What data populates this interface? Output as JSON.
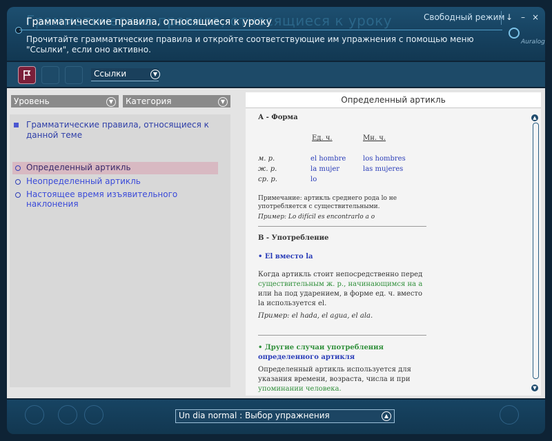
{
  "header": {
    "ghost_title": "Грамматические правила, относящиеся к уроку",
    "title": "Грамматические правила, относящиеся к уроку",
    "subtitle": "Прочитайте грамматические правила и откройте соответствующие им упражнения с помощью меню \"Ссылки\", если оно активно.",
    "mode_label": "Свободный режим",
    "brand": "Auralog",
    "help_icon": "↓",
    "minimize_icon": "–",
    "close_icon": "×"
  },
  "toolbar": {
    "links_label": "Ссылки"
  },
  "left": {
    "filter_level": "Уровень",
    "filter_category": "Категория",
    "group_title": "Грамматические правила, относящиеся к данной теме",
    "rules": [
      "Определенный артикль",
      "Неопределенный артикль",
      "Настоящее время изъявительного наклонения"
    ]
  },
  "right": {
    "header": "Определенный артикль",
    "sec_a": "А - Форма",
    "col_sing": "Ед. ч.",
    "col_plur": "Мн. ч.",
    "rows": [
      {
        "label": "м. р.",
        "sing": "el hombre",
        "plur": "los hombres"
      },
      {
        "label": "ж. р.",
        "sing": "la mujer",
        "plur": "las mujeres"
      },
      {
        "label": "ср. р.",
        "sing": "lo",
        "plur": ""
      }
    ],
    "note1": "Примечание: артикль среднего рода lo не",
    "note2": "употребляется с существительными.",
    "example1": "Пример: Lo difícil es encontrarlo a o",
    "sec_b": "В - Употребление",
    "sub1": "• El вместо la",
    "p1_1": "Когда артикль стоит непосредственно перед",
    "p1_2": "существительным ж. р., начинающимся на а",
    "p1_3": "или ha под ударением, в форме ед. ч. вместо",
    "p1_4": "la используется el.",
    "example2": "Пример: el hada, el agua, el ala.",
    "sub2_1": "• Другие случаи употребления",
    "sub2_2": "определенного артикля",
    "p2_1": "Определенный артикль используется для",
    "p2_2": "указания времени, возраста, числа и при",
    "p2_3": "упоминании человека."
  },
  "footer": {
    "exercise_select": "Un dia normal : Выбор упражнения"
  }
}
